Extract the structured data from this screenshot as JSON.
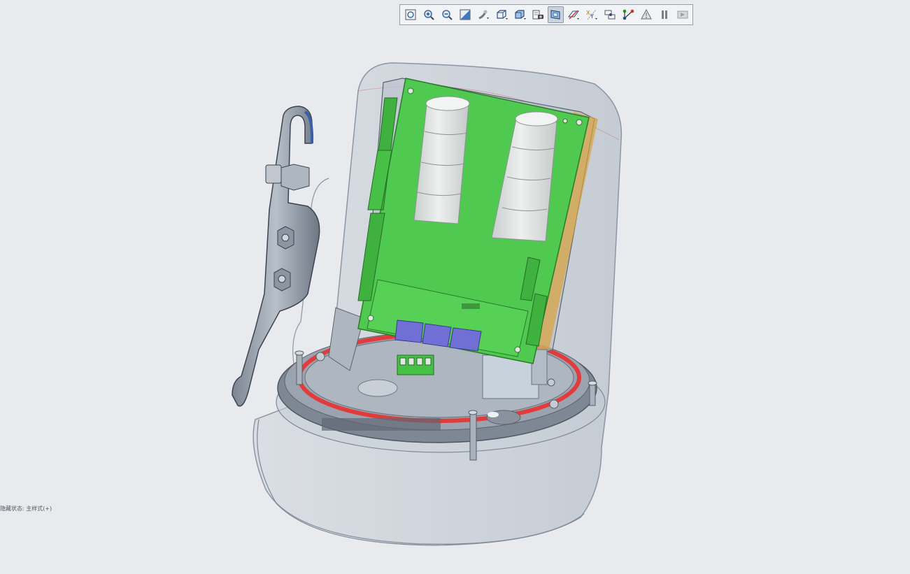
{
  "toolbar": {
    "buttons": [
      {
        "name": "refit-icon",
        "active": false
      },
      {
        "name": "zoom-in-icon",
        "active": false
      },
      {
        "name": "zoom-out-icon",
        "active": false
      },
      {
        "name": "repaint-icon",
        "active": false
      },
      {
        "name": "reorient-icon",
        "active": false
      },
      {
        "name": "saved-orientations-icon",
        "active": false
      },
      {
        "name": "display-style-icon",
        "active": false
      },
      {
        "name": "view-manager-icon",
        "active": false
      },
      {
        "name": "perspective-view-icon",
        "active": true
      },
      {
        "name": "datum-display-icon",
        "active": false
      },
      {
        "name": "annotation-display-icon",
        "active": false
      },
      {
        "name": "spin-center-icon",
        "active": false
      },
      {
        "name": "csys-display-icon",
        "active": false
      },
      {
        "name": "point-display-icon",
        "active": false
      },
      {
        "name": "pause-icon",
        "active": false
      },
      {
        "name": "next-view-icon",
        "active": false
      }
    ]
  },
  "colors": {
    "background": "#e8eaee",
    "pcb": "#4fc94f",
    "capacitor": "#d8dcdc",
    "housing": "#c3cad3",
    "gasket": "#e23b3b",
    "connector": "#6f6fd6"
  },
  "status": {
    "text": "隐藏状态: 主样式(+)"
  }
}
